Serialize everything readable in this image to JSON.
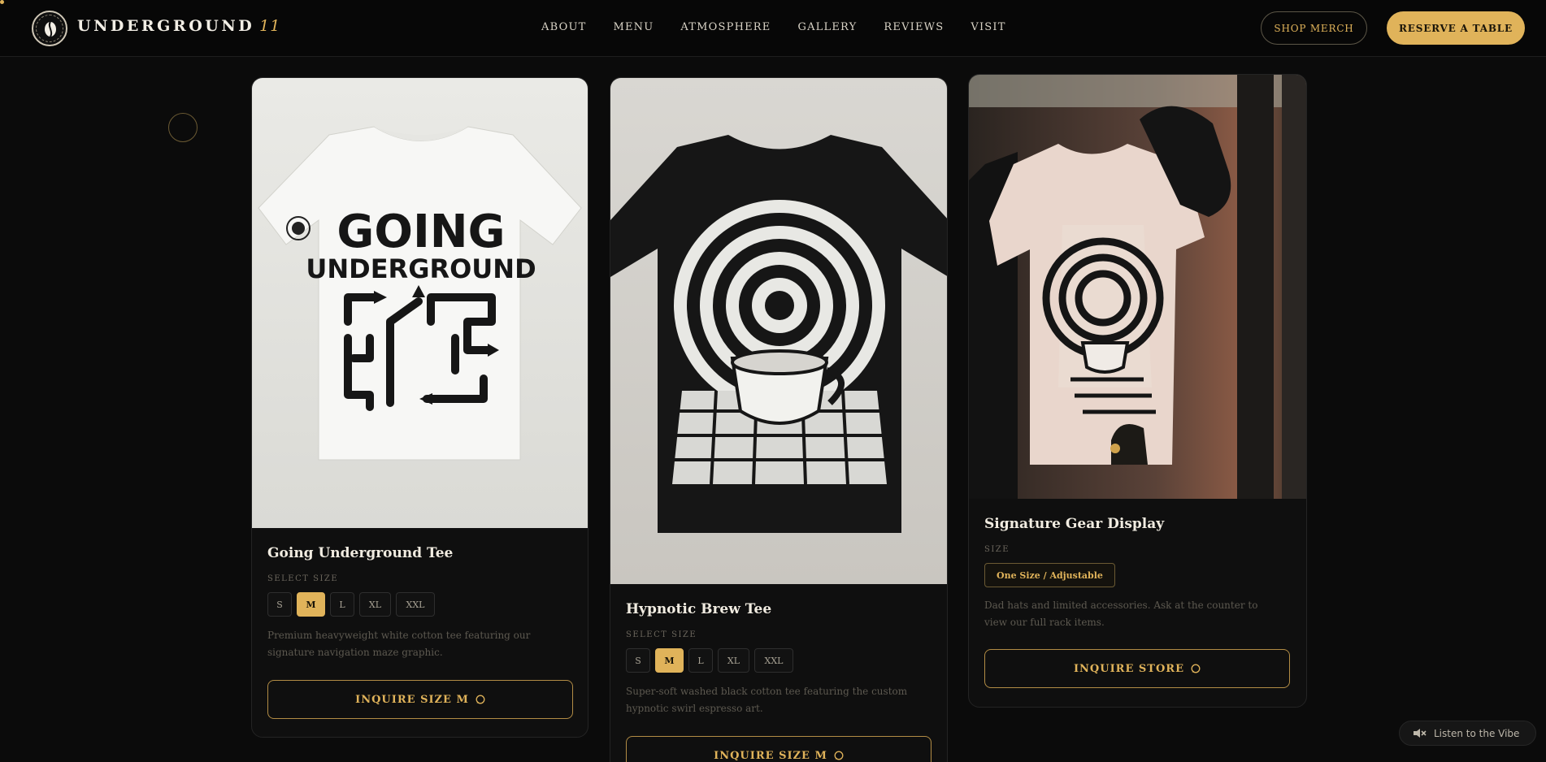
{
  "brand": {
    "name": "UNDERGROUND",
    "number": "11"
  },
  "nav": {
    "links": [
      "ABOUT",
      "MENU",
      "ATMOSPHERE",
      "GALLERY",
      "REVIEWS",
      "VISIT"
    ],
    "shop_label": "SHOP MERCH",
    "reserve_label": "RESERVE A TABLE"
  },
  "products": [
    {
      "title": "Going Underground Tee",
      "size_label": "SELECT SIZE",
      "sizes": [
        "S",
        "M",
        "L",
        "XL",
        "XXL"
      ],
      "selected_size": "M",
      "description": "Premium heavyweight white cotton tee featuring our signature navigation maze graphic.",
      "cta": "INQUIRE SIZE M",
      "shirt_text_line1": "GOING",
      "shirt_text_line2": "UNDERGROUND"
    },
    {
      "title": "Hypnotic Brew Tee",
      "size_label": "SELECT SIZE",
      "sizes": [
        "S",
        "M",
        "L",
        "XL",
        "XXL"
      ],
      "selected_size": "M",
      "description": "Super-soft washed black cotton tee featuring the custom hypnotic swirl espresso art.",
      "cta": "INQUIRE SIZE M"
    },
    {
      "title": "Signature Gear Display",
      "size_label": "SIZE",
      "size_value": "One Size / Adjustable",
      "description": "Dad hats and limited accessories. Ask at the counter to view our full rack items.",
      "cta": "INQUIRE STORE"
    }
  ],
  "audio": {
    "label": "Listen to the Vibe"
  },
  "colors": {
    "accent": "#e0b35a",
    "background": "#0b0b0b",
    "card": "#0f0f0f"
  },
  "icons": [
    "coffee-bean-icon",
    "whatsapp-icon",
    "speaker-muted-icon"
  ]
}
